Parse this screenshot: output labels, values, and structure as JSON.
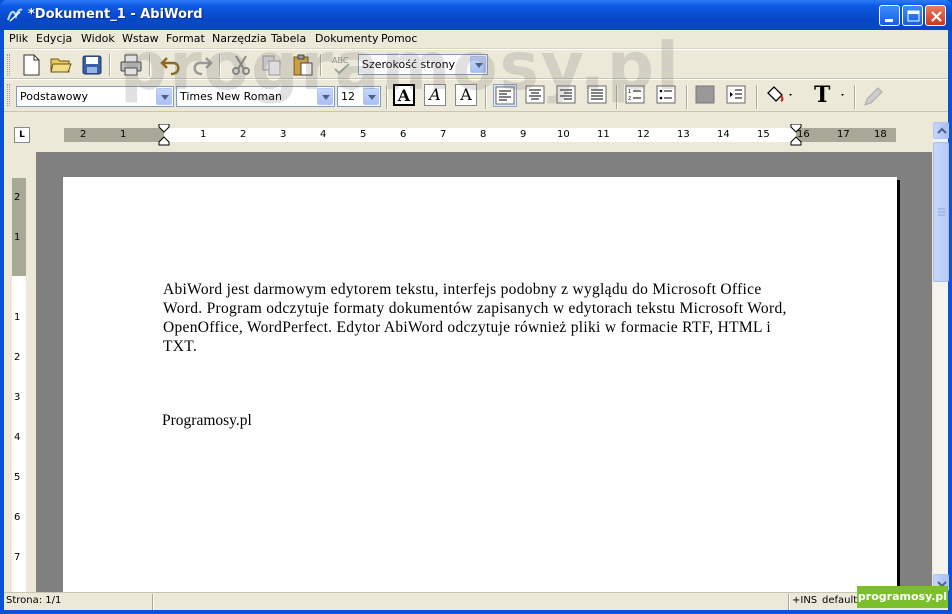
{
  "window": {
    "title": "*Dokument_1 - AbiWord",
    "controls": {
      "minimize": "minimize",
      "maximize": "maximize",
      "close": "close"
    }
  },
  "menu": [
    "Plik",
    "Edycja",
    "Widok",
    "Wstaw",
    "Format",
    "Narzędzia",
    "Tabela",
    "Dokumenty",
    "Pomoc"
  ],
  "toolbar": {
    "zoom": "Szerokość strony",
    "style": "Podstawowy",
    "font": "Times New Roman",
    "size": "12",
    "bold": "A",
    "italic": "A",
    "underline": "A",
    "text_color": "T"
  },
  "ruler": {
    "horizontal": [
      "2",
      "1",
      "1",
      "2",
      "3",
      "4",
      "5",
      "6",
      "7",
      "8",
      "9",
      "10",
      "11",
      "12",
      "13",
      "14",
      "15",
      "16",
      "17",
      "18"
    ],
    "vertical": [
      "2",
      "1",
      "1",
      "2",
      "3",
      "4",
      "5",
      "6",
      "7"
    ],
    "tab_selector": "L"
  },
  "document": {
    "paragraph1": "AbiWord jest darmowym edytorem tekstu, interfejs podobny z wyglądu do Microsoft Office Word. Program odczytuje formaty dokumentów zapisanych w edytorach tekstu Microsoft Word, OpenOffice, WordPerfect. Edytor AbiWord odczytuje również pliki w formacie RTF, HTML i TXT.",
    "paragraph2": "Programosy.pl"
  },
  "status": {
    "page": "Strona: 1/1",
    "mode": "+INS",
    "lang": "default",
    "badge": "programosy.pl"
  },
  "watermark": "programosy.pl",
  "colors": {
    "title_bar": "#0a52d8",
    "doc_bg": "#808080",
    "badge": "#7cbf2c"
  }
}
